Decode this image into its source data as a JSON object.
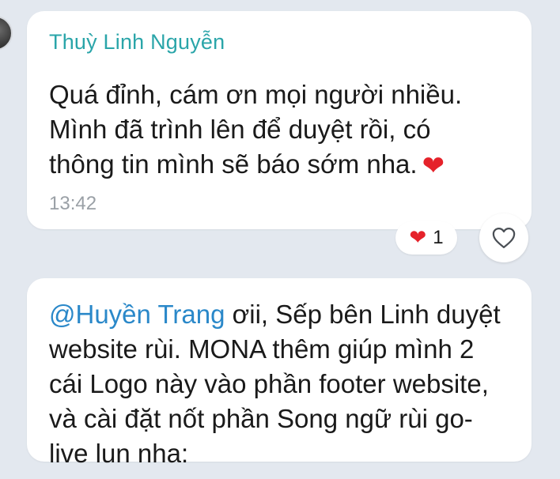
{
  "messages": [
    {
      "sender": "Thuỳ Linh Nguyễn",
      "lines": [
        "Quá đỉnh, cám ơn mọi người nhiều.",
        "Mình đã trình lên để duyệt rồi, có",
        "thông tin mình sẽ báo sớm nha."
      ],
      "time": "13:42",
      "reaction": {
        "emoji": "❤",
        "count": "1"
      }
    },
    {
      "mention": "@Huyền Trang",
      "lines": [
        " ơii, Sếp bên Linh duyệt",
        "website rùi. MONA thêm giúp mình 2",
        "cái Logo này vào phần footer website,",
        "và cài đặt nốt phần Song ngữ rùi go-",
        "live lun nha:"
      ]
    }
  ],
  "icons": {
    "inline_heart": "heart-emoji",
    "react_button": "heart-outline-icon"
  },
  "colors": {
    "background": "#e3e8ef",
    "sender": "#2aa5a9",
    "mention": "#2a88c9",
    "heart": "#e5222a"
  }
}
